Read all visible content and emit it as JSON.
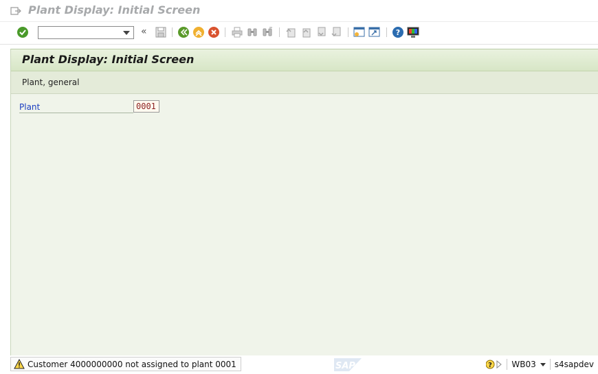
{
  "window": {
    "title": "Plant Display: Initial Screen"
  },
  "toolbar": {
    "command_field": {
      "value": "",
      "placeholder": ""
    },
    "double_chevron": "«",
    "icons": [
      "enter-icon",
      "save-icon",
      "back-icon",
      "exit-icon",
      "cancel-icon",
      "print-icon",
      "find-icon",
      "find-next-icon",
      "first-page-icon",
      "previous-page-icon",
      "next-page-icon",
      "last-page-icon",
      "create-session-icon",
      "shortcut-icon",
      "help-icon",
      "customize-layout-icon"
    ],
    "colors": {
      "enter": "#4a9a2a",
      "back": "#5a9a2a",
      "exit": "#f0b030",
      "cancel": "#d9532f",
      "help": "#2b6cb0"
    }
  },
  "main": {
    "header": "Plant Display: Initial Screen",
    "section_title": "Plant, general",
    "fields": [
      {
        "label": "Plant",
        "value": "0001"
      }
    ]
  },
  "statusbar": {
    "message": "Customer 4000000000 not assigned to plant 0001",
    "message_type": "warning",
    "transaction": "WB03",
    "system": "s4sapdev",
    "logo": "SAP"
  }
}
